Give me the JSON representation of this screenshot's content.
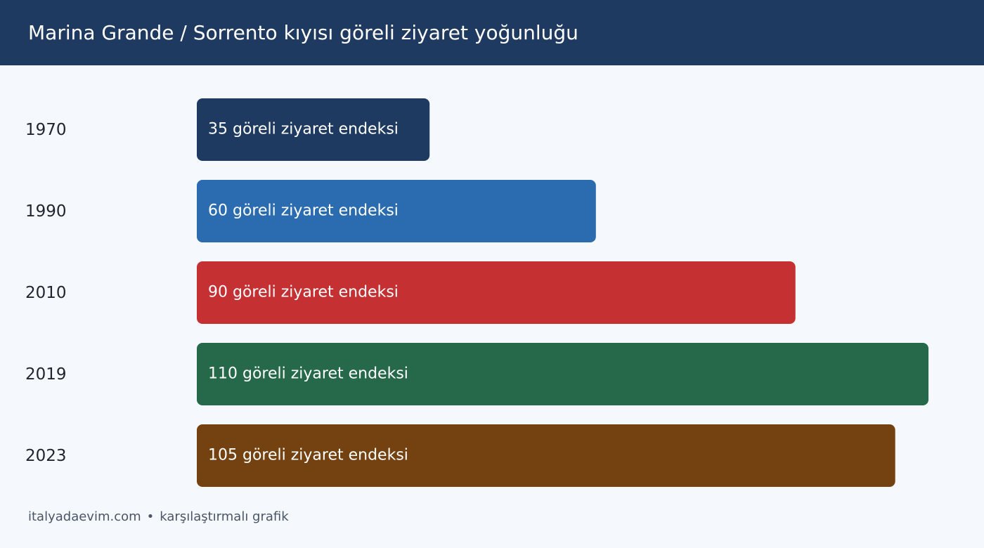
{
  "header": {
    "title": "Marina Grande / Sorrento kıyısı göreli ziyaret yoğunluğu"
  },
  "footer": {
    "site": "italyadaevim.com",
    "separator": "•",
    "caption": "karşılaştırmalı grafik"
  },
  "chart_data": {
    "type": "bar",
    "orientation": "horizontal",
    "title": "Marina Grande / Sorrento kıyısı göreli ziyaret yoğunluğu",
    "categories": [
      "1970",
      "1990",
      "2010",
      "2019",
      "2023"
    ],
    "values": [
      35,
      60,
      90,
      110,
      105
    ],
    "value_label_suffix": " göreli ziyaret endeksi",
    "colors": [
      "#1f3a60",
      "#2b6cb0",
      "#c53032",
      "#26694a",
      "#744210"
    ],
    "xlim": [
      0,
      110
    ],
    "grid": false,
    "legend": "none"
  }
}
